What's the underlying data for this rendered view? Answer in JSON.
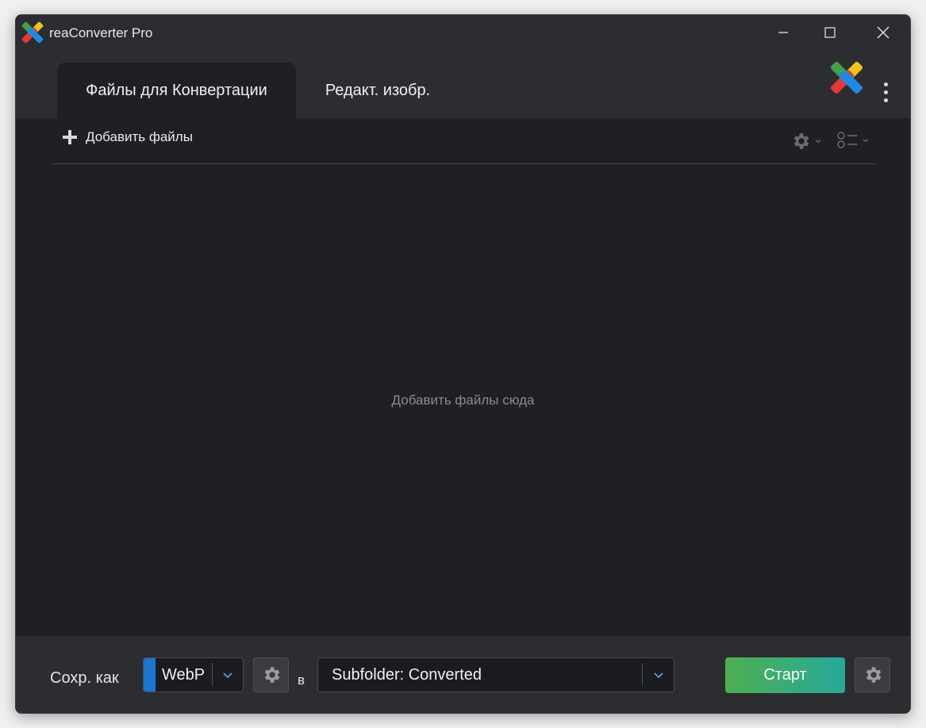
{
  "window": {
    "title": "reaConverter Pro",
    "icons": {
      "logo": "reaconverter-logo-icon",
      "minimize": "minimize-icon",
      "maximize": "maximize-icon",
      "close": "close-icon"
    }
  },
  "tabs": [
    {
      "label": "Файлы для Конвертации",
      "active": true
    },
    {
      "label": "Редакт. изобр.",
      "active": false
    }
  ],
  "header": {
    "menu_icon": "more-vertical-icon"
  },
  "toolbar": {
    "add_files_label": "Добавить файлы",
    "add_icon": "plus-icon",
    "settings_icon": "gear-icon",
    "view_icon": "list-view-icon"
  },
  "dropzone": {
    "hint": "Добавить файлы сюда"
  },
  "footer": {
    "save_as_label": "Сохр. как",
    "format": {
      "value": "WebP",
      "swatch_color": "#1976d2"
    },
    "to_label": "в",
    "destination": {
      "value": "Subfolder: Converted"
    },
    "start_label": "Старт"
  },
  "colors": {
    "window_bg": "#1f2023",
    "chrome_bg": "#2b2d31",
    "accent_blue": "#1976d2",
    "start_gradient_from": "#4caf50",
    "start_gradient_to": "#27a99a"
  }
}
